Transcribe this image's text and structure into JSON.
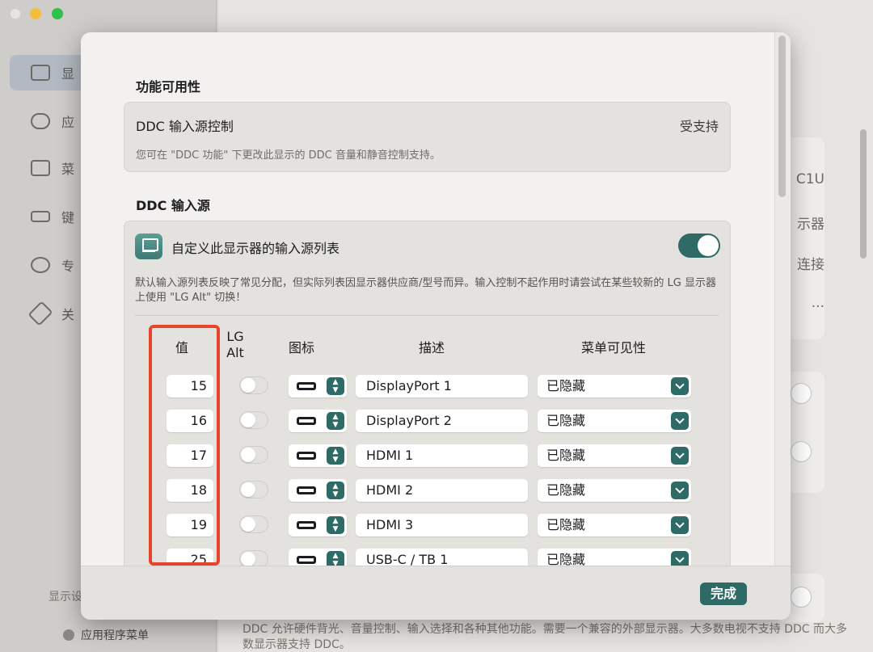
{
  "background": {
    "sidebar_items": [
      "显",
      "应",
      "菜",
      "键",
      "专",
      "关"
    ],
    "panel_texts": [
      "C1U",
      "示器",
      "连接",
      "..."
    ],
    "sidebar_bottom": "显示设",
    "app_menu_label": "应用程序菜单",
    "footer_text": "DDC 允许硬件背光、音量控制、输入选择和各种其他功能。需要一个兼容的外部显示器。大多数电视不支持 DDC 而大多数显示器支持 DDC。"
  },
  "feature_section": {
    "title": "功能可用性",
    "row_title": "DDC 输入源控制",
    "row_value": "受支持",
    "row_desc": "您可在 \"DDC 功能\" 下更改此显示的 DDC 音量和静音控制支持。"
  },
  "input_section": {
    "title": "DDC 输入源",
    "custom_label": "自定义此显示器的输入源列表",
    "custom_desc": "默认输入源列表反映了常见分配，但实际列表因显示器供应商/型号而异。输入控制不起作用时请尝试在某些较新的 LG 显示器上使用 \"LG Alt\" 切换！",
    "headers": {
      "value": "值",
      "lg_alt": "LG\nAlt",
      "icon": "图标",
      "desc": "描述",
      "menu": "菜单可见性"
    },
    "rows": [
      {
        "value": "15",
        "desc": "DisplayPort 1",
        "menu": "已隐藏"
      },
      {
        "value": "16",
        "desc": "DisplayPort 2",
        "menu": "已隐藏"
      },
      {
        "value": "17",
        "desc": "HDMI 1",
        "menu": "已隐藏"
      },
      {
        "value": "18",
        "desc": "HDMI 2",
        "menu": "已隐藏"
      },
      {
        "value": "19",
        "desc": "HDMI 3",
        "menu": "已隐藏"
      },
      {
        "value": "25",
        "desc": "USB-C / TB 1",
        "menu": "已隐藏"
      }
    ]
  },
  "footer": {
    "done_label": "完成"
  },
  "colors": {
    "accent": "#2e6b66",
    "highlight": "#e8432d"
  }
}
